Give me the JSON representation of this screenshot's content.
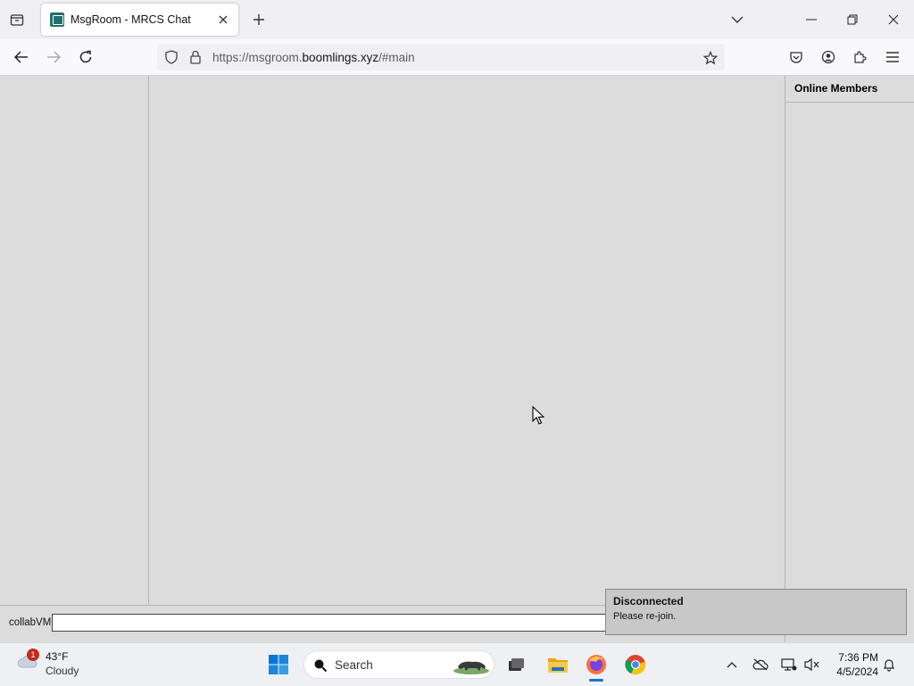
{
  "browser": {
    "tab_title": "MsgRoom - MRCS Chat",
    "url_prefix": "https://msgroom.",
    "url_host": "boomlings.xyz",
    "url_suffix": "/#main"
  },
  "page": {
    "members_title": "Online Members",
    "name_label": "collabVM",
    "message_input_value": "",
    "toast_title": "Disconnected",
    "toast_message": "Please re-join."
  },
  "taskbar": {
    "weather_badge": "1",
    "weather_temp": "43°F",
    "weather_condition": "Cloudy",
    "search_placeholder": "Search",
    "time": "7:36 PM",
    "date": "4/5/2024",
    "apps": [
      "task-view",
      "file-explorer",
      "firefox",
      "chrome"
    ]
  },
  "colors": {
    "page_bg": "#dcdcdc",
    "accent_blue": "#1a73c8",
    "favicon_teal": "#1f6f6b",
    "badge_red": "#c42b1c"
  }
}
